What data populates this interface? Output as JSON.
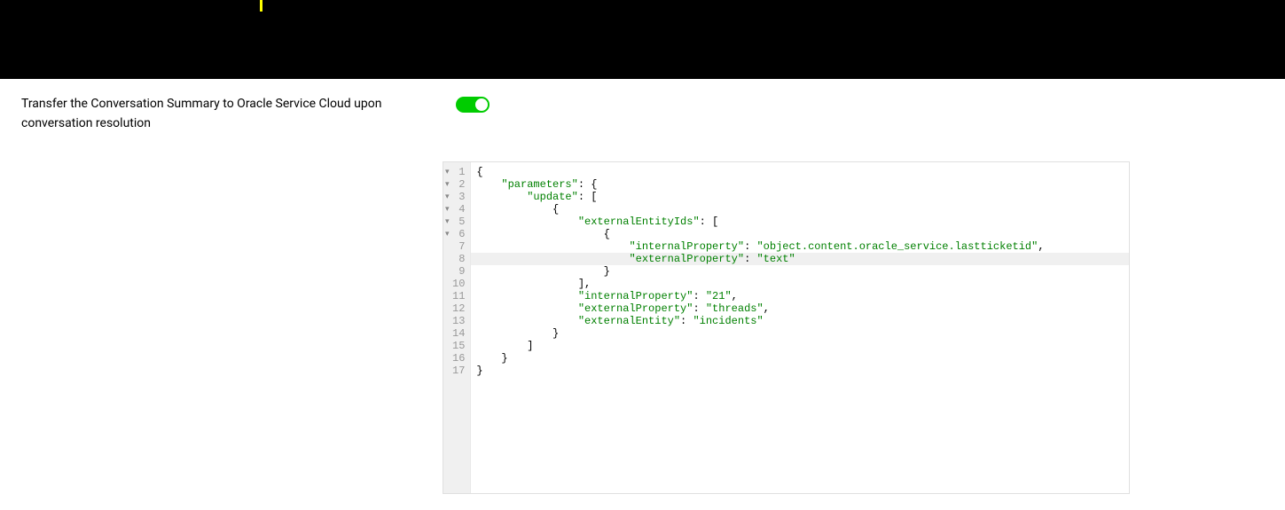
{
  "topBar": {
    "hasCursor": true
  },
  "setting": {
    "label": "Transfer the Conversation Summary to Oracle Service Cloud upon conversation resolution",
    "toggleOn": true
  },
  "editor": {
    "activeLine": 8,
    "lines": [
      {
        "num": "1",
        "fold": true
      },
      {
        "num": "2",
        "fold": true
      },
      {
        "num": "3",
        "fold": true
      },
      {
        "num": "4",
        "fold": true
      },
      {
        "num": "5",
        "fold": true
      },
      {
        "num": "6",
        "fold": true
      },
      {
        "num": "7",
        "fold": false
      },
      {
        "num": "8",
        "fold": false
      },
      {
        "num": "9",
        "fold": false
      },
      {
        "num": "10",
        "fold": false
      },
      {
        "num": "11",
        "fold": false
      },
      {
        "num": "12",
        "fold": false
      },
      {
        "num": "13",
        "fold": false
      },
      {
        "num": "14",
        "fold": false
      },
      {
        "num": "15",
        "fold": false
      },
      {
        "num": "16",
        "fold": false
      },
      {
        "num": "17",
        "fold": false
      }
    ],
    "code": {
      "l1": "{",
      "l2_key": "\"parameters\"",
      "l2_after": ": {",
      "l3_key": "\"update\"",
      "l3_after": ": [",
      "l4": "{",
      "l5_key": "\"externalEntityIds\"",
      "l5_after": ": [",
      "l6": "{",
      "l7_key": "\"internalProperty\"",
      "l7_val": "\"object.content.oracle_service.lastticketid\"",
      "l8_key": "\"externalProperty\"",
      "l8_val": "\"text\"",
      "l9": "}",
      "l10": "],",
      "l11_key": "\"internalProperty\"",
      "l11_val": "\"21\"",
      "l12_key": "\"externalProperty\"",
      "l12_val": "\"threads\"",
      "l13_key": "\"externalEntity\"",
      "l13_val": "\"incidents\"",
      "l14": "}",
      "l15": "]",
      "l16": "}",
      "l17": "}"
    }
  }
}
